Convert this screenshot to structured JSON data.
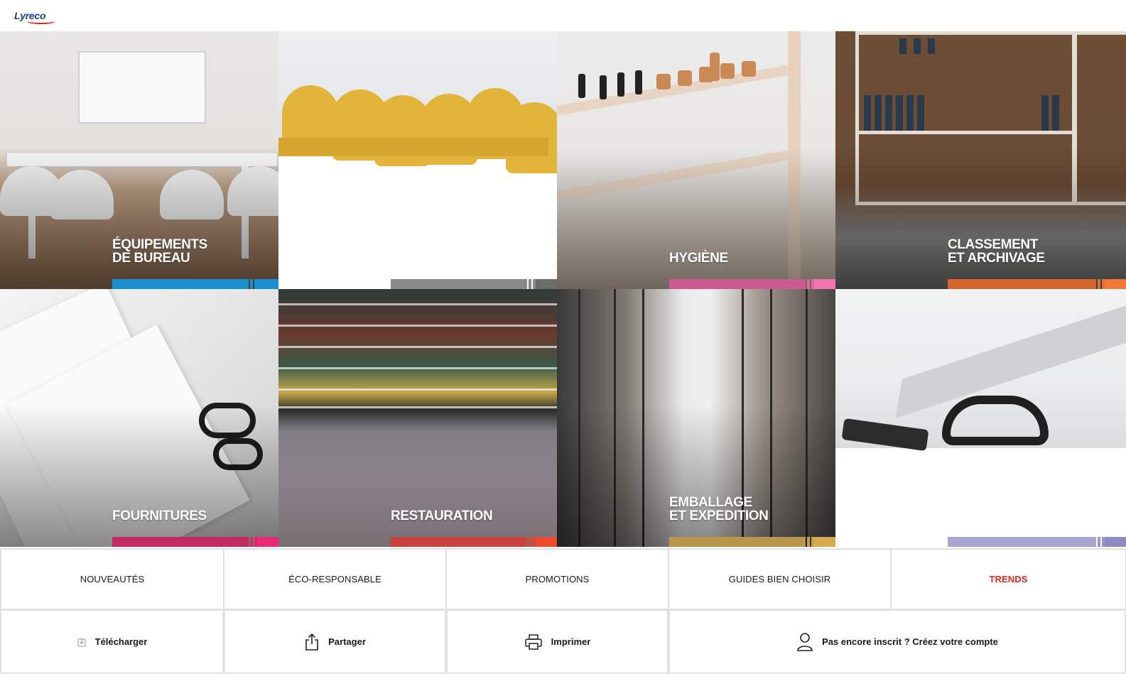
{
  "header": {
    "logo_text": "Lyreco",
    "brand_color": "#1e3f8f",
    "accent_color": "#e1261c"
  },
  "tiles": [
    {
      "id": "equipements",
      "line1": "ÉQUIPEMENTS",
      "line2": "DE BUREAU",
      "color": "#1a8fd1"
    },
    {
      "id": "gloves",
      "line1": "",
      "line2": "",
      "color": "#8a8a8a"
    },
    {
      "id": "hygiene",
      "line1": "HYGIÈNE",
      "line2": "",
      "color": "#d4568f"
    },
    {
      "id": "classement",
      "line1": "CLASSEMENT",
      "line2": "ET ARCHIVAGE",
      "color": "#e86a24"
    },
    {
      "id": "fournitures",
      "line1": "FOURNITURES",
      "line2": "",
      "color": "#d81f5f"
    },
    {
      "id": "restauration",
      "line1": "RESTAURATION",
      "line2": "",
      "color": "#e3412c"
    },
    {
      "id": "emballage",
      "line1": "EMBALLAGE",
      "line2": "ET EXPEDITION",
      "color": "#c9a24a"
    },
    {
      "id": "trends-image",
      "line1": "",
      "line2": "",
      "color": "#8f89c4"
    }
  ],
  "category_nav": [
    {
      "label": "NOUVEAUTÉS"
    },
    {
      "label": "ÉCO-RESPONSABLE"
    },
    {
      "label": "PROMOTIONS"
    },
    {
      "label": "GUIDES BIEN CHOISIR"
    },
    {
      "label": "TRENDS",
      "color": "#e1261c"
    }
  ],
  "actions": [
    {
      "label": "Télécharger",
      "icon": "download-icon"
    },
    {
      "label": "Partager",
      "icon": "share-icon"
    },
    {
      "label": "Imprimer",
      "icon": "print-icon"
    },
    {
      "label": "Pas encore inscrit ? Créez votre compte",
      "icon": "user-icon"
    }
  ]
}
